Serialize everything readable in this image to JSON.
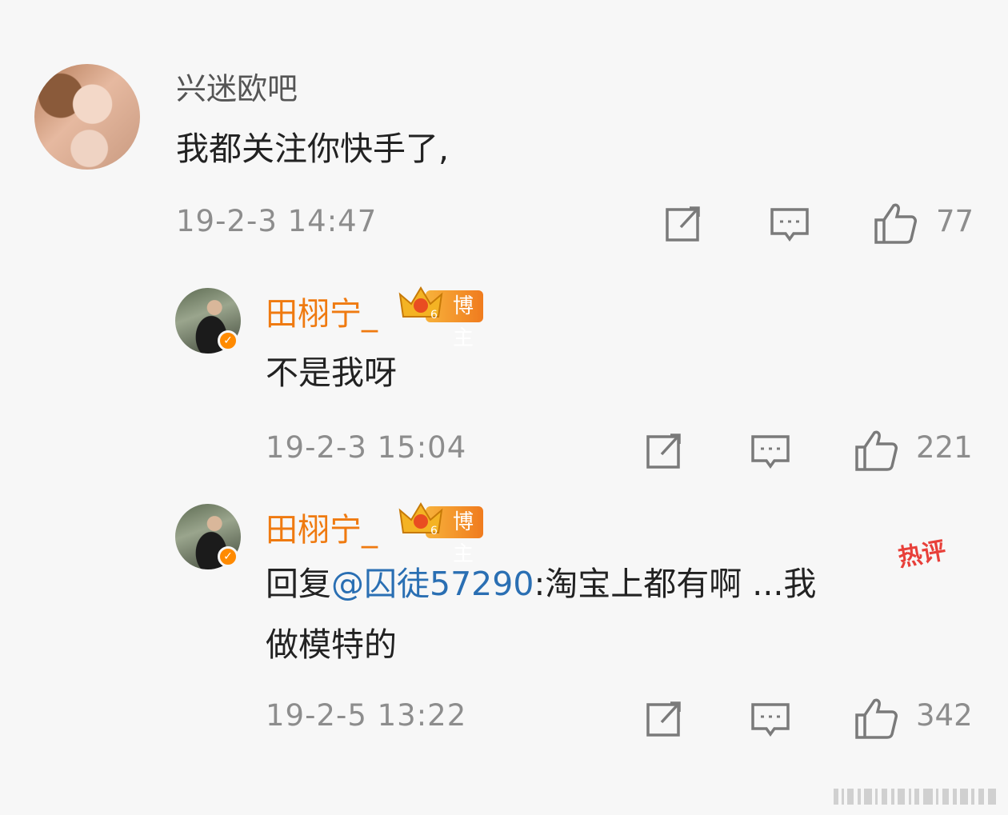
{
  "comments": [
    {
      "username": "兴迷欧吧",
      "text": "我都关注你快手了,",
      "timestamp": "19-2-3 14:47",
      "likes": "77"
    }
  ],
  "replies": [
    {
      "username": "田栩宁_",
      "badge": "博主",
      "text": "不是我呀",
      "timestamp": "19-2-3 15:04",
      "likes": "221"
    },
    {
      "username": "田栩宁_",
      "badge": "博主",
      "hot_tag": "热评",
      "text_prefix": "回复",
      "mention": "@囚徒57290",
      "text_rest": ":淘宝上都有啊 ...我",
      "text_line2": "做模特的",
      "timestamp": "19-2-5 13:22",
      "likes": "342"
    }
  ],
  "icons": {
    "share": "share-icon",
    "comment": "comment-icon",
    "like": "thumbs-up-icon",
    "verified": "verified-icon",
    "crown": "crown-icon"
  },
  "colors": {
    "owner_name": "#ef7a10",
    "mention": "#2a6fb3",
    "hot": "#e8403a",
    "meta": "#8d8d8d"
  }
}
